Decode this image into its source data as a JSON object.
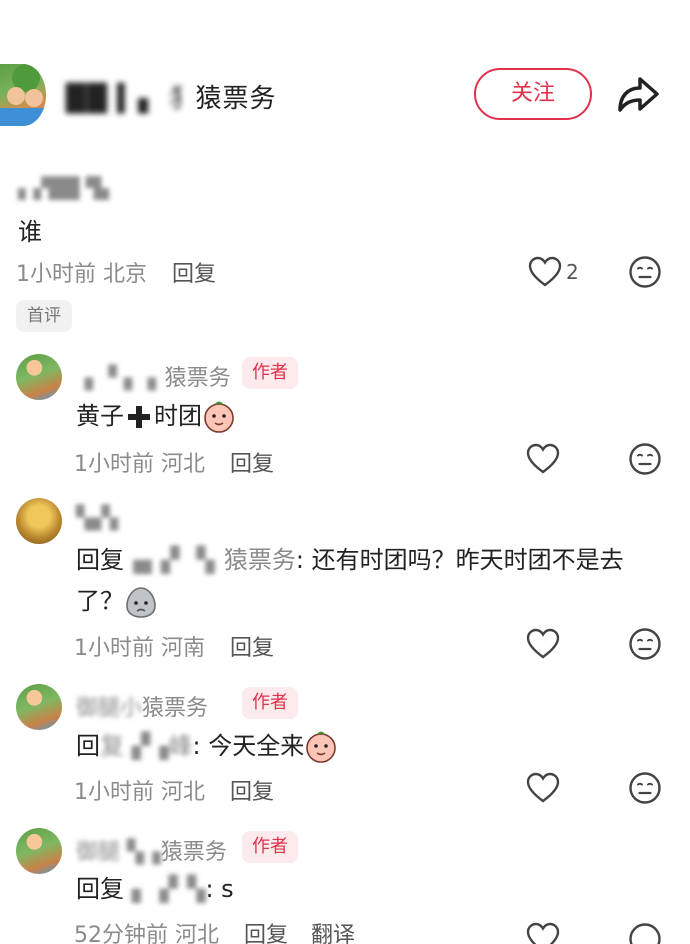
{
  "header": {
    "name_hidden": "██ ▍▖ 犭",
    "name_visible": "猿票务",
    "follow_label": "关注",
    "icons": {
      "share": "share-arrow-icon",
      "avatar": "avatar-image"
    }
  },
  "top_comment": {
    "name": "▖▞██ ▜▖",
    "text": "谁",
    "time": "1小时前",
    "location": "北京",
    "reply_label": "回复",
    "like_count": "2",
    "badge": "首评"
  },
  "replies": [
    {
      "name_hidden": "▗ ▝ ▖ ▖",
      "name_visible": "猿票务",
      "tag": "作者",
      "text_a": "黄子",
      "text_b": "时团",
      "time": "1小时前",
      "location": "河北",
      "reply_label": "回复"
    },
    {
      "name_hidden": "▚▞▖",
      "reply_prefix": "回复",
      "mention_hidden": "▗▖▞ ▝▖",
      "mention_visible": "猿票务",
      "text_line1": ": 还有时团吗？昨天时团不是去",
      "text_line2": "了？",
      "time": "1小时前",
      "location": "河南",
      "reply_label": "回复"
    },
    {
      "name_hidden": "御腿小",
      "name_visible": "猿票务",
      "tag": "作者",
      "reply_prefix": "回",
      "mention_hidden": "复 ▞▗峰",
      "text": ": 今天全来",
      "time": "1小时前",
      "location": "河北",
      "reply_label": "回复"
    },
    {
      "name_hidden": "御腿 ▚▗",
      "name_visible": "猿票务",
      "tag": "作者",
      "reply_prefix": "回复",
      "mention_hidden": "▖▗▘▚",
      "text": ": s",
      "time": "52分钟前",
      "location": "河北",
      "reply_label": "回复",
      "translate_label": "翻译"
    }
  ],
  "colors": {
    "accent": "#e0324b",
    "meta": "#8b8b8b",
    "tag_bg": "#fdeaec"
  }
}
